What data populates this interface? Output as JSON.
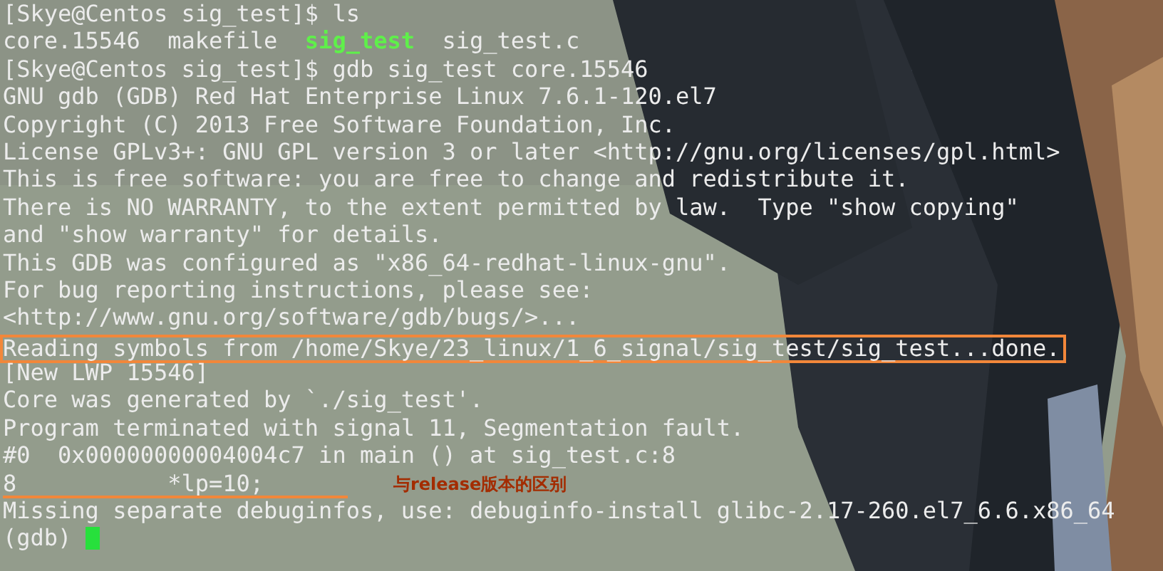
{
  "terminal": {
    "lines": [
      {
        "kind": "plain",
        "segments": [
          {
            "kind": "plain",
            "text": "[Skye@Centos sig_test]$ ls"
          }
        ]
      },
      {
        "kind": "plain",
        "segments": [
          {
            "kind": "plain",
            "text": "core.15546  makefile  "
          },
          {
            "kind": "executable",
            "text": "sig_test"
          },
          {
            "kind": "plain",
            "text": "  sig_test.c"
          }
        ]
      },
      {
        "kind": "plain",
        "segments": [
          {
            "kind": "plain",
            "text": "[Skye@Centos sig_test]$ gdb sig_test core.15546"
          }
        ]
      },
      {
        "kind": "plain",
        "segments": [
          {
            "kind": "plain",
            "text": "GNU gdb (GDB) Red Hat Enterprise Linux 7.6.1-120.el7"
          }
        ]
      },
      {
        "kind": "plain",
        "segments": [
          {
            "kind": "plain",
            "text": "Copyright (C) 2013 Free Software Foundation, Inc."
          }
        ]
      },
      {
        "kind": "plain",
        "segments": [
          {
            "kind": "plain",
            "text": "License GPLv3+: GNU GPL version 3 or later <http://gnu.org/licenses/gpl.html>"
          }
        ]
      },
      {
        "kind": "plain",
        "segments": [
          {
            "kind": "plain",
            "text": "This is free software: you are free to change and redistribute it."
          }
        ]
      },
      {
        "kind": "plain",
        "segments": [
          {
            "kind": "plain",
            "text": "There is NO WARRANTY, to the extent permitted by law.  Type \"show copying\""
          }
        ]
      },
      {
        "kind": "plain",
        "segments": [
          {
            "kind": "plain",
            "text": "and \"show warranty\" for details."
          }
        ]
      },
      {
        "kind": "plain",
        "segments": [
          {
            "kind": "plain",
            "text": "This GDB was configured as \"x86_64-redhat-linux-gnu\"."
          }
        ]
      },
      {
        "kind": "plain",
        "segments": [
          {
            "kind": "plain",
            "text": "For bug reporting instructions, please see:"
          }
        ]
      },
      {
        "kind": "plain",
        "segments": [
          {
            "kind": "plain",
            "text": "<http://www.gnu.org/software/gdb/bugs/>..."
          }
        ]
      },
      {
        "kind": "boxed",
        "segments": [
          {
            "kind": "plain",
            "text": "Reading symbols from /home/Skye/23_linux/1_6_signal/sig_test/sig_test...done."
          }
        ]
      },
      {
        "kind": "plain",
        "segments": [
          {
            "kind": "plain",
            "text": "[New LWP 15546]"
          }
        ]
      },
      {
        "kind": "plain",
        "segments": [
          {
            "kind": "plain",
            "text": "Core was generated by `./sig_test'."
          }
        ]
      },
      {
        "kind": "plain",
        "segments": [
          {
            "kind": "plain",
            "text": "Program terminated with signal 11, Segmentation fault."
          }
        ]
      },
      {
        "kind": "plain",
        "segments": [
          {
            "kind": "plain",
            "text": "#0  0x00000000004004c7 in main () at sig_test.c:8"
          }
        ]
      },
      {
        "kind": "annotated",
        "note": "与release版本的区别",
        "segments": [
          {
            "kind": "plain",
            "text": "8           *lp=10;"
          }
        ]
      },
      {
        "kind": "plain",
        "segments": [
          {
            "kind": "plain",
            "text": "Missing separate debuginfos, use: debuginfo-install glibc-2.17-260.el7_6.6.x86_64"
          }
        ]
      },
      {
        "kind": "prompt",
        "segments": [
          {
            "kind": "plain",
            "text": "(gdb) "
          }
        ]
      }
    ]
  }
}
